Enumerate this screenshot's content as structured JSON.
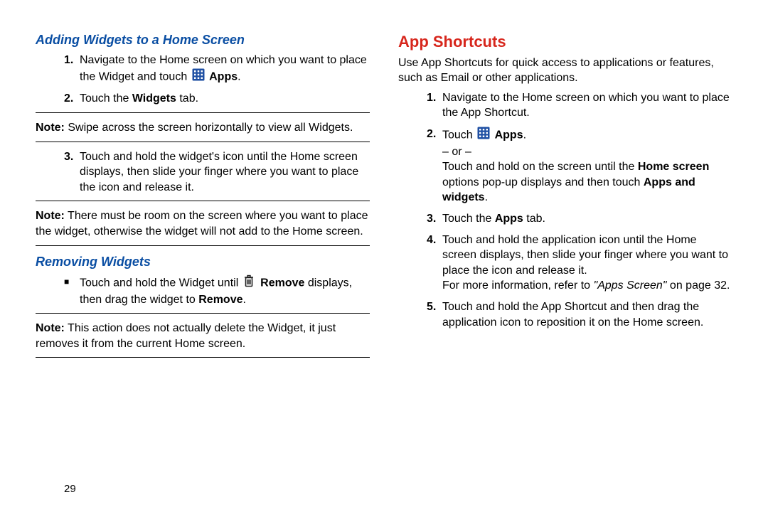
{
  "pageNumber": "29",
  "left": {
    "h_add": "Adding Widgets to a Home Screen",
    "add": {
      "s1a": "Navigate to the Home screen on which you want to place the Widget and touch ",
      "s1b": "Apps",
      "s1c": ".",
      "s2a": "Touch the ",
      "s2b": "Widgets",
      "s2c": " tab."
    },
    "note1": {
      "label": "Note:",
      "text": " Swipe across the screen horizontally to view all Widgets."
    },
    "add3": "Touch and hold the widget's icon until the Home screen displays, then slide your finger where you want to place the icon and release it.",
    "note2": {
      "label": "Note:",
      "text": " There must be room on the screen where you want to place the widget, otherwise the widget will not add to the Home screen."
    },
    "h_remove": "Removing Widgets",
    "remove": {
      "a": "Touch and hold the Widget until ",
      "b": "Remove",
      "c": " displays, then drag the widget to ",
      "d": "Remove",
      "e": "."
    },
    "note3": {
      "label": "Note:",
      "text": " This action does not actually delete the Widget, it just removes it from the current Home screen."
    }
  },
  "right": {
    "h": "App Shortcuts",
    "intro": "Use App Shortcuts for quick access to applications or features, such as Email or other applications.",
    "s1": "Navigate to the Home screen on which you want to place the App Shortcut.",
    "s2": {
      "a": "Touch ",
      "b": "Apps",
      "c": ".",
      "or": "– or –",
      "d": "Touch and hold on the screen until the ",
      "e": "Home screen",
      "f": " options pop-up displays and then touch ",
      "g": "Apps and widgets",
      "h": "."
    },
    "s3": {
      "a": "Touch the ",
      "b": "Apps",
      "c": " tab."
    },
    "s4": {
      "a": "Touch and hold the application icon until the Home screen displays, then slide your finger where you want to place the icon and release it.",
      "b": "For more information, refer to ",
      "c": "\"Apps Screen\"",
      "d": " on page 32."
    },
    "s5": "Touch and hold the App Shortcut and then drag the application icon to reposition it on the Home screen."
  }
}
